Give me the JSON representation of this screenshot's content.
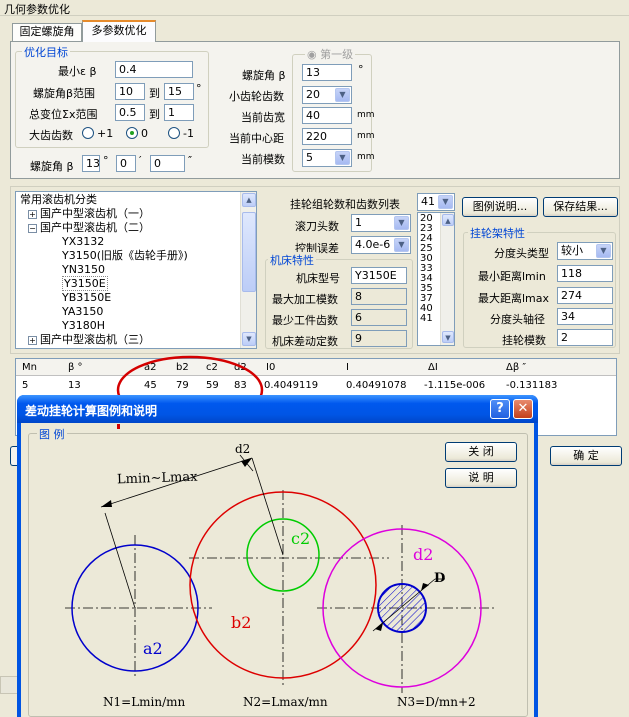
{
  "window": {
    "title": "几何参数优化"
  },
  "tabs": [
    {
      "label": "固定螺旋角"
    },
    {
      "label": "多参数优化"
    }
  ],
  "optimize": {
    "title": "优化目标",
    "min_label": "最小ε β",
    "min_value": "0.4",
    "beta_range_label": "螺旋角β范围",
    "beta_from": "10",
    "to1": "到",
    "beta_to": "15",
    "deg": "°",
    "sum_label": "总变位Σx范围",
    "sum_from": "0.5",
    "to2": "到",
    "sum_to": "1",
    "big_label": "大齿齿数",
    "r1": "+1",
    "r2": "0",
    "r3": "-1"
  },
  "beta_row": {
    "label": "螺旋角 β",
    "deg_value": "13",
    "deg": "°",
    "min_value": "0",
    "min_mark": "′",
    "sec_value": "0",
    "sec_mark": "″"
  },
  "first_stage": {
    "title": "第一级",
    "beta_label": "螺旋角 β",
    "beta_value": "13",
    "beta_unit": "°",
    "pinion_label": "小齿轮齿数",
    "pinion_value": "20",
    "width_label": "当前齿宽",
    "width_value": "40",
    "width_unit": "mm",
    "center_label": "当前中心距",
    "center_value": "220",
    "center_unit": "mm",
    "module_label": "当前模数",
    "module_value": "5",
    "module_unit": "mm"
  },
  "tree": {
    "root": "常用滚齿机分类",
    "items": [
      "国产中型滚齿机（一）",
      "国产中型滚齿机（二）",
      "YX3132",
      "Y3150(旧版《齿轮手册》)",
      "YN3150",
      "Y3150E",
      "YB3150E",
      "YA3150",
      "Y3180H",
      "国产中型滚齿机（三）"
    ]
  },
  "gear_set": {
    "label": "挂轮组轮数和齿数列表",
    "value": "41",
    "list": [
      "20",
      "23",
      "24",
      "25",
      "30",
      "33",
      "34",
      "35",
      "37",
      "40",
      "41"
    ]
  },
  "hob": {
    "label": "滚刀头数",
    "value": "1",
    "err_label": "控制误差",
    "err_value": "4.0e-6"
  },
  "machine": {
    "title": "机床特性",
    "model_label": "机床型号",
    "model_value": "Y3150E",
    "maxmod_label": "最大加工模数",
    "maxmod_value": "8",
    "minteeth_label": "最少工件齿数",
    "minteeth_value": "6",
    "diff_label": "机床差动定数",
    "diff_value": "9"
  },
  "buttons": {
    "legend": "图例说明...",
    "save": "保存结果...",
    "ok": "确 定"
  },
  "frame": {
    "title": "挂轮架特性",
    "head_label": "分度头类型",
    "head_value": "较小",
    "lmin_label": "最小距离lmin",
    "lmin_value": "118",
    "lmax_label": "最大距离lmax",
    "lmax_value": "274",
    "shaft_label": "分度头轴径",
    "shaft_value": "34",
    "mod_label": "挂轮模数",
    "mod_value": "2"
  },
  "grid": {
    "headers": [
      "Mn",
      "β °",
      "a2",
      "b2",
      "c2",
      "d2",
      "I0",
      "I",
      "ΔI",
      "Δβ ″"
    ],
    "row": [
      "5",
      "13",
      "45",
      "79",
      "59",
      "83",
      "0.4049119",
      "0.40491078",
      "-1.115e-006",
      "-0.131183"
    ]
  },
  "dialog": {
    "title": "差动挂轮计算图例和说明",
    "group": "图 例",
    "close": "关 闭",
    "explain": "说 明",
    "lmin_lmax": "Lmin~Lmax",
    "d2_top": "d2",
    "c2": "c2",
    "d2": "d2",
    "b2": "b2",
    "a2": "a2",
    "D": "D",
    "n1": "N1=Lmin/mn",
    "n2": "N2=Lmax/mn",
    "n3": "N3=D/mn+2",
    "colors": {
      "a2": "#0000cc",
      "b2": "#dd0000",
      "c2": "#00cc00",
      "d2": "#dd00dd"
    }
  },
  "annotation_color": "#d40000"
}
